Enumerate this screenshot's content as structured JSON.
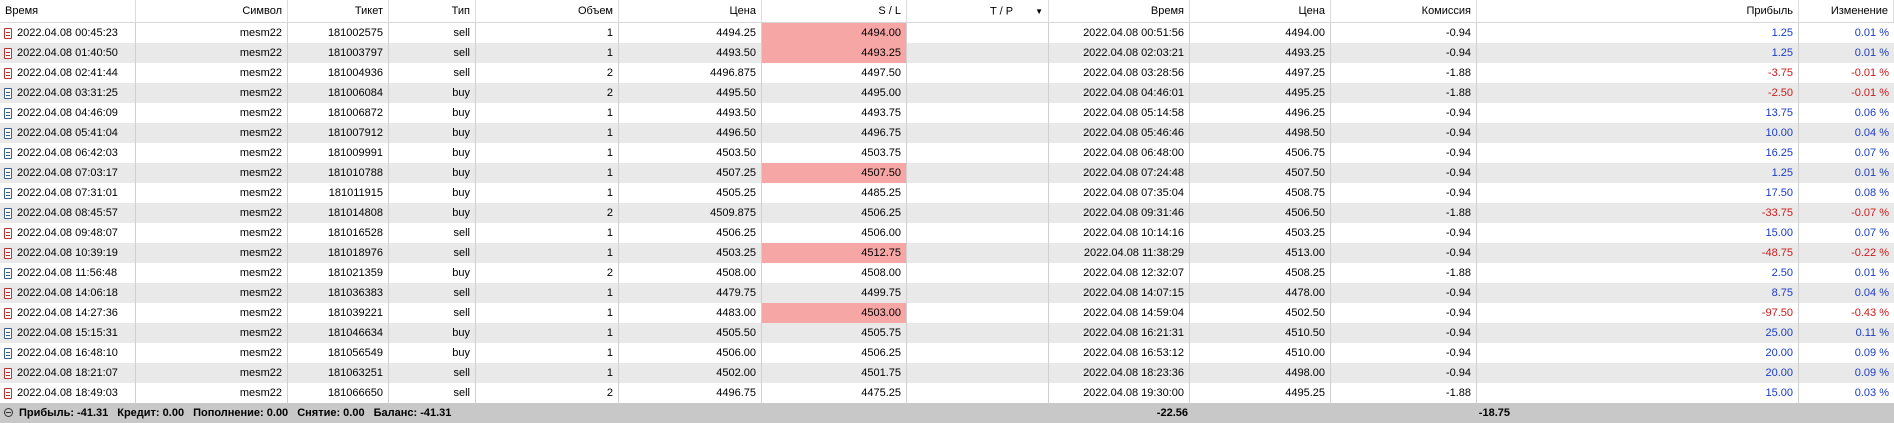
{
  "columns": [
    "Время",
    "Символ",
    "Тикет",
    "Тип",
    "Объем",
    "Цена",
    "S / L",
    "T / P",
    "Время",
    "Цена",
    "Комиссия",
    "Прибыль",
    "Изменение"
  ],
  "rows": [
    {
      "open_time": "2022.04.08 00:45:23",
      "symbol": "mesm22",
      "ticket": "181002575",
      "type": "sell",
      "volume": "1",
      "price": "4494.25",
      "sl": "4494.00",
      "sl_hit": true,
      "tp": "",
      "close_time": "2022.04.08 00:51:56",
      "close_price": "4494.00",
      "commission": "-0.94",
      "profit": "1.25",
      "change": "0.01 %"
    },
    {
      "open_time": "2022.04.08 01:40:50",
      "symbol": "mesm22",
      "ticket": "181003797",
      "type": "sell",
      "volume": "1",
      "price": "4493.50",
      "sl": "4493.25",
      "sl_hit": true,
      "tp": "",
      "close_time": "2022.04.08 02:03:21",
      "close_price": "4493.25",
      "commission": "-0.94",
      "profit": "1.25",
      "change": "0.01 %"
    },
    {
      "open_time": "2022.04.08 02:41:44",
      "symbol": "mesm22",
      "ticket": "181004936",
      "type": "sell",
      "volume": "2",
      "price": "4496.875",
      "sl": "4497.50",
      "sl_hit": false,
      "tp": "",
      "close_time": "2022.04.08 03:28:56",
      "close_price": "4497.25",
      "commission": "-1.88",
      "profit": "-3.75",
      "change": "-0.01 %"
    },
    {
      "open_time": "2022.04.08 03:31:25",
      "symbol": "mesm22",
      "ticket": "181006084",
      "type": "buy",
      "volume": "2",
      "price": "4495.50",
      "sl": "4495.00",
      "sl_hit": false,
      "tp": "",
      "close_time": "2022.04.08 04:46:01",
      "close_price": "4495.25",
      "commission": "-1.88",
      "profit": "-2.50",
      "change": "-0.01 %"
    },
    {
      "open_time": "2022.04.08 04:46:09",
      "symbol": "mesm22",
      "ticket": "181006872",
      "type": "buy",
      "volume": "1",
      "price": "4493.50",
      "sl": "4493.75",
      "sl_hit": false,
      "tp": "",
      "close_time": "2022.04.08 05:14:58",
      "close_price": "4496.25",
      "commission": "-0.94",
      "profit": "13.75",
      "change": "0.06 %"
    },
    {
      "open_time": "2022.04.08 05:41:04",
      "symbol": "mesm22",
      "ticket": "181007912",
      "type": "buy",
      "volume": "1",
      "price": "4496.50",
      "sl": "4496.75",
      "sl_hit": false,
      "tp": "",
      "close_time": "2022.04.08 05:46:46",
      "close_price": "4498.50",
      "commission": "-0.94",
      "profit": "10.00",
      "change": "0.04 %"
    },
    {
      "open_time": "2022.04.08 06:42:03",
      "symbol": "mesm22",
      "ticket": "181009991",
      "type": "buy",
      "volume": "1",
      "price": "4503.50",
      "sl": "4503.75",
      "sl_hit": false,
      "tp": "",
      "close_time": "2022.04.08 06:48:00",
      "close_price": "4506.75",
      "commission": "-0.94",
      "profit": "16.25",
      "change": "0.07 %"
    },
    {
      "open_time": "2022.04.08 07:03:17",
      "symbol": "mesm22",
      "ticket": "181010788",
      "type": "buy",
      "volume": "1",
      "price": "4507.25",
      "sl": "4507.50",
      "sl_hit": true,
      "tp": "",
      "close_time": "2022.04.08 07:24:48",
      "close_price": "4507.50",
      "commission": "-0.94",
      "profit": "1.25",
      "change": "0.01 %"
    },
    {
      "open_time": "2022.04.08 07:31:01",
      "symbol": "mesm22",
      "ticket": "181011915",
      "type": "buy",
      "volume": "1",
      "price": "4505.25",
      "sl": "4485.25",
      "sl_hit": false,
      "tp": "",
      "close_time": "2022.04.08 07:35:04",
      "close_price": "4508.75",
      "commission": "-0.94",
      "profit": "17.50",
      "change": "0.08 %"
    },
    {
      "open_time": "2022.04.08 08:45:57",
      "symbol": "mesm22",
      "ticket": "181014808",
      "type": "buy",
      "volume": "2",
      "price": "4509.875",
      "sl": "4506.25",
      "sl_hit": false,
      "tp": "",
      "close_time": "2022.04.08 09:31:46",
      "close_price": "4506.50",
      "commission": "-1.88",
      "profit": "-33.75",
      "change": "-0.07 %"
    },
    {
      "open_time": "2022.04.08 09:48:07",
      "symbol": "mesm22",
      "ticket": "181016528",
      "type": "sell",
      "volume": "1",
      "price": "4506.25",
      "sl": "4506.00",
      "sl_hit": false,
      "tp": "",
      "close_time": "2022.04.08 10:14:16",
      "close_price": "4503.25",
      "commission": "-0.94",
      "profit": "15.00",
      "change": "0.07 %"
    },
    {
      "open_time": "2022.04.08 10:39:19",
      "symbol": "mesm22",
      "ticket": "181018976",
      "type": "sell",
      "volume": "1",
      "price": "4503.25",
      "sl": "4512.75",
      "sl_hit": true,
      "tp": "",
      "close_time": "2022.04.08 11:38:29",
      "close_price": "4513.00",
      "commission": "-0.94",
      "profit": "-48.75",
      "change": "-0.22 %"
    },
    {
      "open_time": "2022.04.08 11:56:48",
      "symbol": "mesm22",
      "ticket": "181021359",
      "type": "buy",
      "volume": "2",
      "price": "4508.00",
      "sl": "4508.00",
      "sl_hit": false,
      "tp": "",
      "close_time": "2022.04.08 12:32:07",
      "close_price": "4508.25",
      "commission": "-1.88",
      "profit": "2.50",
      "change": "0.01 %"
    },
    {
      "open_time": "2022.04.08 14:06:18",
      "symbol": "mesm22",
      "ticket": "181036383",
      "type": "sell",
      "volume": "1",
      "price": "4479.75",
      "sl": "4499.75",
      "sl_hit": false,
      "tp": "",
      "close_time": "2022.04.08 14:07:15",
      "close_price": "4478.00",
      "commission": "-0.94",
      "profit": "8.75",
      "change": "0.04 %"
    },
    {
      "open_time": "2022.04.08 14:27:36",
      "symbol": "mesm22",
      "ticket": "181039221",
      "type": "sell",
      "volume": "1",
      "price": "4483.00",
      "sl": "4503.00",
      "sl_hit": true,
      "tp": "",
      "close_time": "2022.04.08 14:59:04",
      "close_price": "4502.50",
      "commission": "-0.94",
      "profit": "-97.50",
      "change": "-0.43 %"
    },
    {
      "open_time": "2022.04.08 15:15:31",
      "symbol": "mesm22",
      "ticket": "181046634",
      "type": "buy",
      "volume": "1",
      "price": "4505.50",
      "sl": "4505.75",
      "sl_hit": false,
      "tp": "",
      "close_time": "2022.04.08 16:21:31",
      "close_price": "4510.50",
      "commission": "-0.94",
      "profit": "25.00",
      "change": "0.11 %"
    },
    {
      "open_time": "2022.04.08 16:48:10",
      "symbol": "mesm22",
      "ticket": "181056549",
      "type": "buy",
      "volume": "1",
      "price": "4506.00",
      "sl": "4506.25",
      "sl_hit": false,
      "tp": "",
      "close_time": "2022.04.08 16:53:12",
      "close_price": "4510.00",
      "commission": "-0.94",
      "profit": "20.00",
      "change": "0.09 %"
    },
    {
      "open_time": "2022.04.08 18:21:07",
      "symbol": "mesm22",
      "ticket": "181063251",
      "type": "sell",
      "volume": "1",
      "price": "4502.00",
      "sl": "4501.75",
      "sl_hit": false,
      "tp": "",
      "close_time": "2022.04.08 18:23:36",
      "close_price": "4498.00",
      "commission": "-0.94",
      "profit": "20.00",
      "change": "0.09 %"
    },
    {
      "open_time": "2022.04.08 18:49:03",
      "symbol": "mesm22",
      "ticket": "181066650",
      "type": "sell",
      "volume": "2",
      "price": "4496.75",
      "sl": "4475.25",
      "sl_hit": false,
      "tp": "",
      "close_time": "2022.04.08 19:30:00",
      "close_price": "4495.25",
      "commission": "-1.88",
      "profit": "15.00",
      "change": "0.03 %"
    }
  ],
  "footer": {
    "profit": "Прибыль: -41.31",
    "credit": "Кредит: 0.00",
    "deposit": "Пополнение: 0.00",
    "withdrawal": "Снятие: 0.00",
    "balance": "Баланс: -41.31",
    "commission_total": "-22.56",
    "profit_total": "-18.75"
  },
  "colors": {
    "row_alt": "#e9e9e9",
    "sl_hit": "#f7a6a6",
    "positive": "#1a3cc8",
    "negative": "#d01818",
    "footer_bg": "#c8c8c8"
  },
  "icons": {
    "sort": "sort-down-arrow-icon",
    "footer": "collapse-circle-icon",
    "sell_row": "sell-order-icon",
    "buy_row": "buy-order-icon"
  }
}
